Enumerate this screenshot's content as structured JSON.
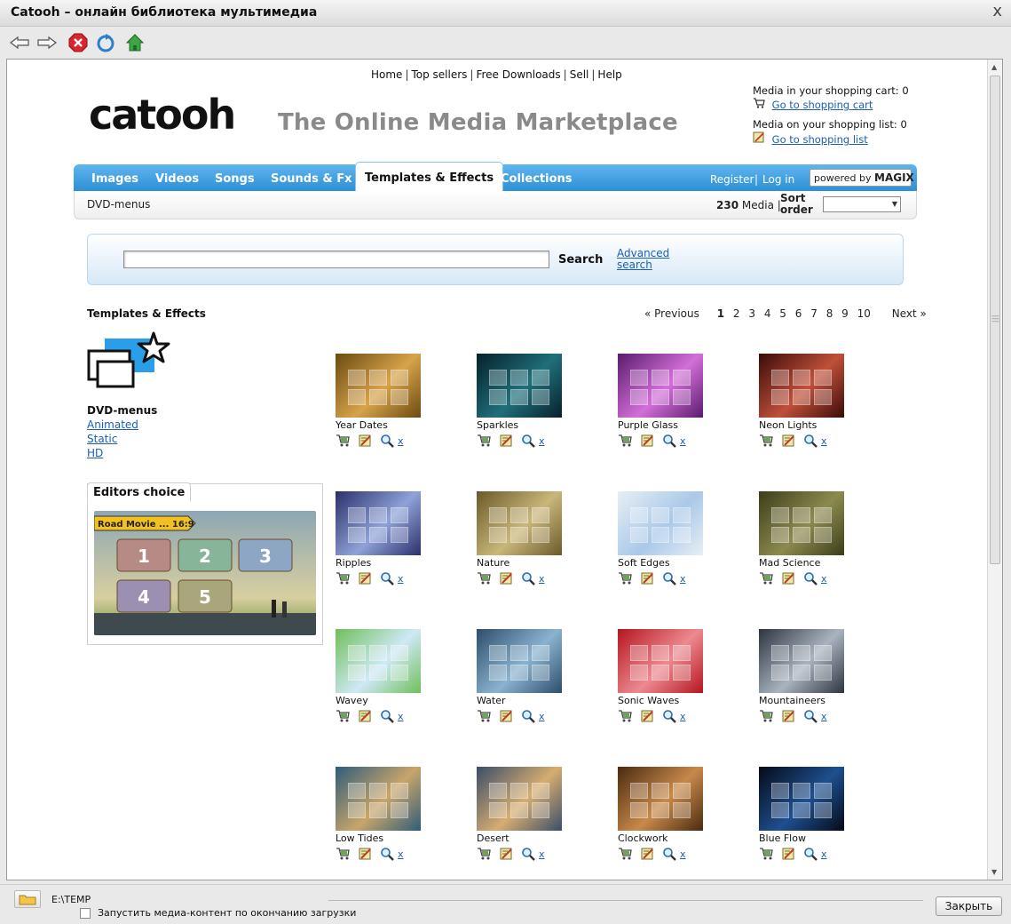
{
  "window": {
    "title": "Catooh – онлайн библиотека мультимедиа",
    "close_glyph": "x"
  },
  "browser_toolbar": [
    "back-icon",
    "forward-icon",
    "stop-icon",
    "refresh-icon",
    "home-icon"
  ],
  "topnav": [
    "Home",
    "Top sellers",
    "Free Downloads",
    "Sell",
    "Help"
  ],
  "logo_text": "catooh",
  "tagline": "The Online Media Marketplace",
  "cart": {
    "cart_label": "Media in your shopping cart: 0",
    "cart_link": "Go to shopping cart",
    "list_label": "Media on your shopping list: 0",
    "list_link": "Go to shopping list"
  },
  "tabs": [
    "Images",
    "Videos",
    "Songs",
    "Sounds & Fx",
    "Templates & Effects",
    "Collections"
  ],
  "active_tab": "Templates & Effects",
  "account": {
    "register": "Register",
    "login": "Log in",
    "powered_prefix": "powered by",
    "powered_brand": "MAGIX"
  },
  "subbar": {
    "crumb": "DVD-menus",
    "count": "230",
    "count_label": "Media",
    "sort_label_1": "Sort",
    "sort_label_2": "order",
    "sort_value": ""
  },
  "search": {
    "button": "Search",
    "advanced_1": "Advanced",
    "advanced_2": "search",
    "value": ""
  },
  "section_title": "Templates & Effects",
  "pager": {
    "previous": "« Previous",
    "pages": [
      "1",
      "2",
      "3",
      "4",
      "5",
      "6",
      "7",
      "8",
      "9",
      "10"
    ],
    "current": "1",
    "next": "Next »"
  },
  "category": {
    "title": "DVD-menus",
    "links": [
      "Animated",
      "Static",
      "HD"
    ]
  },
  "editors_choice": {
    "tab": "Editors choice",
    "banner": "Road Movie ... 16:9"
  },
  "items": [
    {
      "name": "Year Dates",
      "c1": "#6b4a12",
      "c2": "#d7a34a"
    },
    {
      "name": "Sparkles",
      "c1": "#06202a",
      "c2": "#1f6f7a"
    },
    {
      "name": "Purple Glass",
      "c1": "#5a1b6c",
      "c2": "#d36fd8"
    },
    {
      "name": "Neon Lights",
      "c1": "#3a0b08",
      "c2": "#c0503a"
    },
    {
      "name": "Ripples",
      "c1": "#2a2f6a",
      "c2": "#8fa2d8"
    },
    {
      "name": "Nature",
      "c1": "#6a5a2a",
      "c2": "#c9b679"
    },
    {
      "name": "Soft Edges",
      "c1": "#e8eef5",
      "c2": "#a9c9e8"
    },
    {
      "name": "Mad Science",
      "c1": "#3b3d18",
      "c2": "#8d8a4f"
    },
    {
      "name": "Wavey",
      "c1": "#6fbf5a",
      "c2": "#cfe9f6"
    },
    {
      "name": "Water",
      "c1": "#2d4d6b",
      "c2": "#8ab3cf"
    },
    {
      "name": "Sonic Waves",
      "c1": "#b5151f",
      "c2": "#ec8a8f"
    },
    {
      "name": "Mountaineers",
      "c1": "#2c3440",
      "c2": "#a9b4c0"
    },
    {
      "name": "Low Tides",
      "c1": "#2e5c7a",
      "c2": "#c8a56a"
    },
    {
      "name": "Desert",
      "c1": "#3a4d69",
      "c2": "#d6ad70"
    },
    {
      "name": "Clockwork",
      "c1": "#4a2a10",
      "c2": "#c8894a"
    },
    {
      "name": "Blue Flow",
      "c1": "#050a18",
      "c2": "#1e4f8f"
    }
  ],
  "item_actions": [
    "cart-icon",
    "list-icon",
    "preview-icon"
  ],
  "item_remove": "x",
  "download_bar": {
    "path": "E:\\TEMP",
    "checkbox_label": "Запустить медиа-контент по окончанию загрузки",
    "close_button": "Закрыть"
  },
  "colors": {
    "tab_blue": "#2d8fd6",
    "link_blue": "#1a5fb4",
    "tagline_gray": "#8a8a8a"
  }
}
